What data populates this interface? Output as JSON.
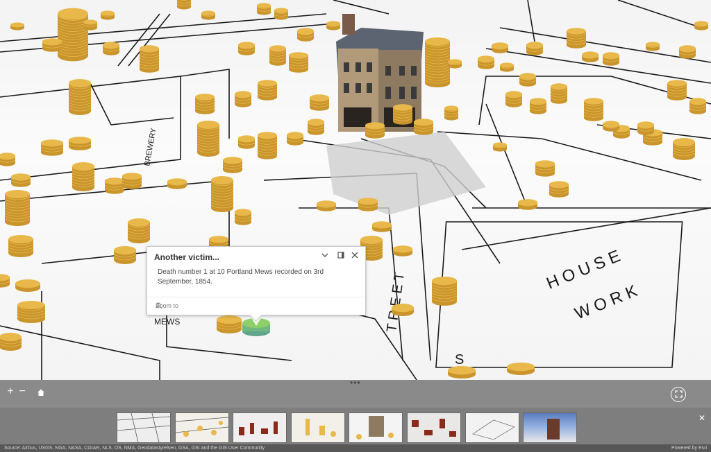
{
  "popup": {
    "title": "Another victim...",
    "body": "Death number 1 at 10 Portland Mews recorded on 3rd September, 1854.",
    "zoom_label": "Zoom to"
  },
  "map_labels": {
    "work": "W O R K",
    "house": "H O U S E",
    "brewery": "BREWERY",
    "mews": "MEWS",
    "street_letters": "T R E E T",
    "s_letter": "S"
  },
  "attribution": {
    "source": "Source: Airbus, USGS, NGA, NASA, CGIAR, NLS, OS, NMA, Geodatastyrelsen, GSA, GSI and the GIS User Community",
    "powered": "Powered by Esri"
  },
  "controls": {
    "zoom_in": "+",
    "zoom_out": "−",
    "home_icon": "home-icon",
    "fullscreen_icon": "fullscreen-icon",
    "close_gallery": "✕",
    "handle": "•••"
  },
  "colors": {
    "coin": "#e8b84a",
    "coin_dark": "#c9952c",
    "highlight": "#8fcf6a",
    "toolbar": "#8a8a8a"
  }
}
